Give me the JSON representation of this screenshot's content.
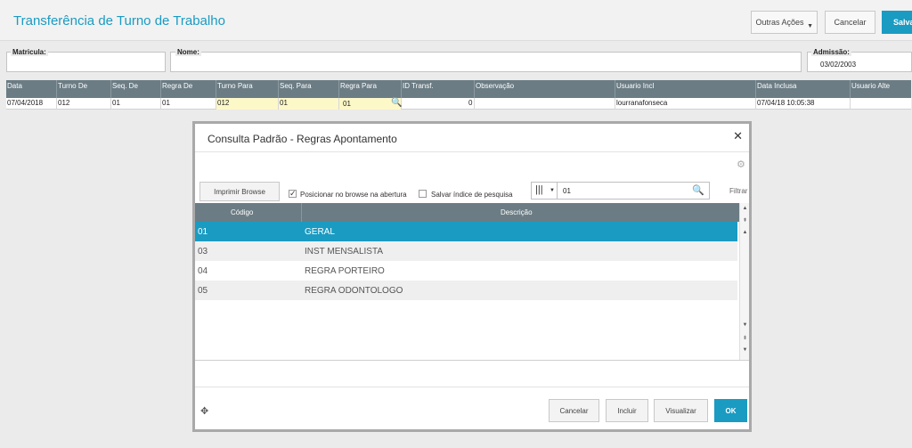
{
  "header": {
    "title": "Transferência de Turno de Trabalho",
    "btn_outras": "Outras Ações",
    "btn_cancelar": "Cancelar",
    "btn_salvar": "Salvar"
  },
  "fields": {
    "matricula_label": "Matricula:",
    "nome_label": "Nome:",
    "admissao_label": "Admissão:",
    "admissao_value": "03/02/2003"
  },
  "grid": {
    "columns": [
      "Data",
      "Turno De",
      "Seq. De",
      "Regra De",
      "Turno Para",
      "Seq. Para",
      "Regra Para",
      "ID Transf.",
      "Observação",
      "Usuario Incl",
      "Data Inclusa",
      "Usuario Alte"
    ],
    "row": {
      "data": "07/04/2018",
      "turno_de": "012",
      "seq_de": "01",
      "regra_de": "01",
      "turno_para": "012",
      "seq_para": "01",
      "regra_para": "01",
      "id_transf": "0",
      "observacao": "",
      "usuario_incl": "lourranafonseca",
      "data_inclusa": "07/04/18 10:05:38",
      "usuario_alte": ""
    }
  },
  "modal": {
    "title": "Consulta Padrão - Regras Apontamento",
    "btn_imprimir": "Imprimir Browse",
    "chk_posicionar": "Posicionar no browse na abertura",
    "chk_posicionar_checked": true,
    "chk_salvar": "Salvar índice de pesquisa",
    "chk_salvar_checked": false,
    "search_value": "01",
    "filtrar": "Filtrar",
    "col_codigo": "Código",
    "col_descricao": "Descrição",
    "rows": [
      {
        "codigo": "01",
        "descricao": "GERAL"
      },
      {
        "codigo": "03",
        "descricao": "INST MENSALISTA"
      },
      {
        "codigo": "04",
        "descricao": "REGRA PORTEIRO"
      },
      {
        "codigo": "05",
        "descricao": "REGRA ODONTOLOGO"
      }
    ],
    "btn_cancelar": "Cancelar",
    "btn_incluir": "Incluir",
    "btn_visualizar": "Visualizar",
    "btn_ok": "OK"
  },
  "colors": {
    "accent": "#1a9bc2",
    "grid_header": "#6b7c84",
    "edit_cell": "#fdf8c8"
  }
}
